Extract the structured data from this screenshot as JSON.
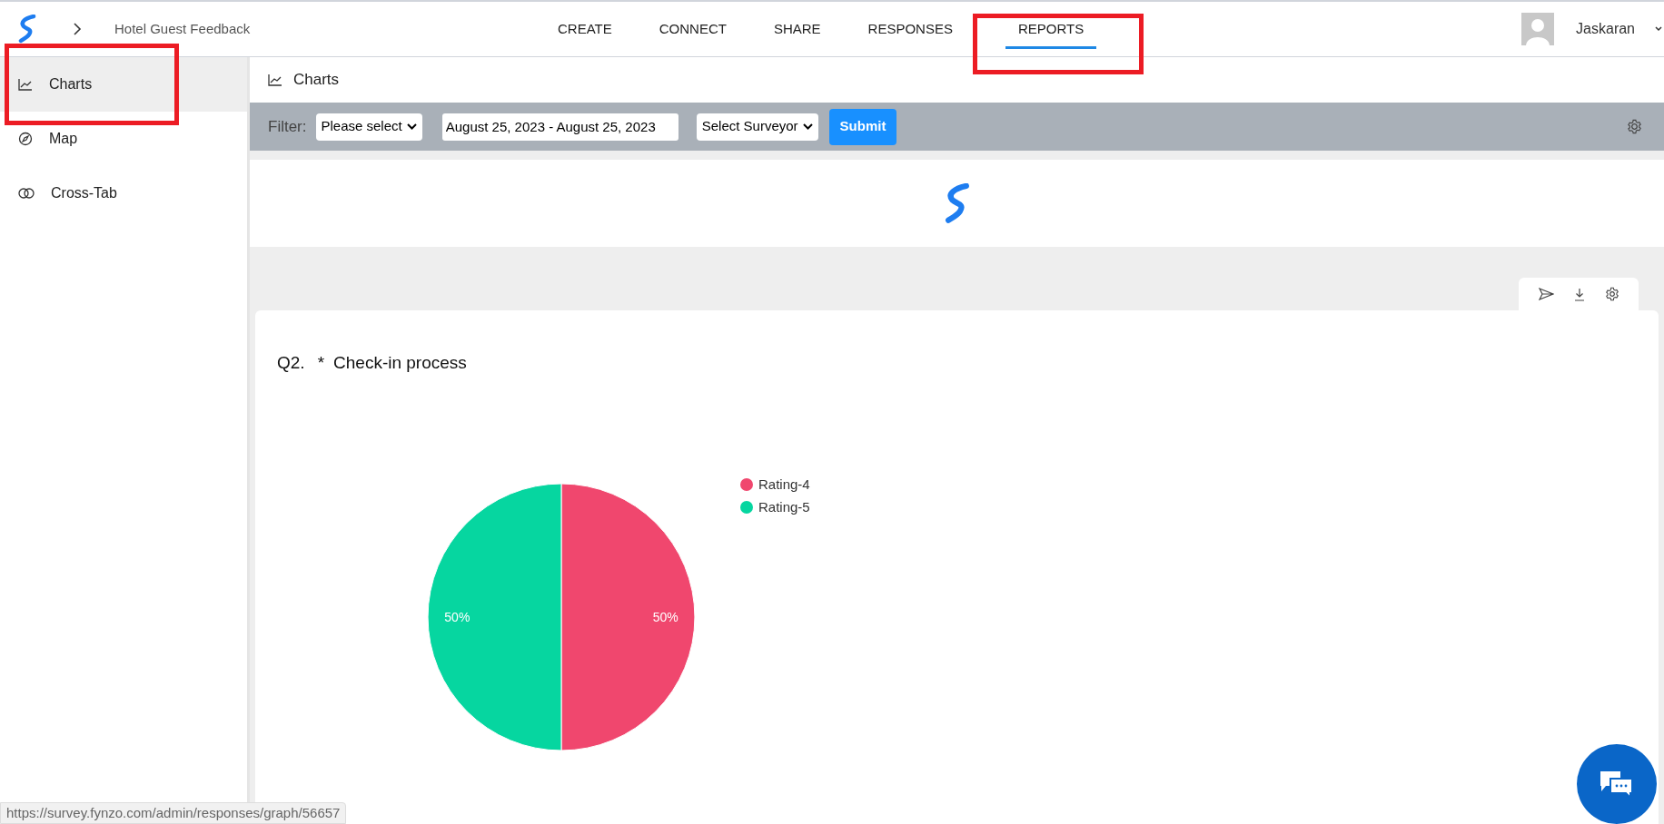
{
  "header": {
    "breadcrumb_title": "Hotel Guest Feedback",
    "nav": [
      {
        "label": "CREATE",
        "selected": false,
        "highlighted": false
      },
      {
        "label": "CONNECT",
        "selected": false,
        "highlighted": false
      },
      {
        "label": "SHARE",
        "selected": false,
        "highlighted": false
      },
      {
        "label": "RESPONSES",
        "selected": false,
        "highlighted": false
      },
      {
        "label": "REPORTS",
        "selected": true,
        "highlighted": true
      }
    ],
    "user": "Jaskaran"
  },
  "sidebar": {
    "items": [
      {
        "label": "Charts",
        "kind": "chart",
        "selected": true,
        "highlighted": true
      },
      {
        "label": "Map",
        "kind": "compass",
        "selected": false,
        "highlighted": false
      },
      {
        "label": "Cross-Tab",
        "kind": "rings",
        "selected": false,
        "highlighted": false
      }
    ]
  },
  "page_title": "Charts",
  "filter": {
    "label": "Filter:",
    "question_select": "Please select",
    "date_range": "August 25, 2023 - August 25, 2023",
    "surveyor_select": "Select Surveyor",
    "submit": "Submit"
  },
  "question": {
    "number": "Q2.",
    "required_mark": "*",
    "title": "Check-in process",
    "chart_data": {
      "type": "pie",
      "categories": [
        "Rating-4",
        "Rating-5"
      ],
      "values": [
        50,
        50
      ],
      "legend": true,
      "colors": [
        "#f0476e",
        "#06d6a0"
      ],
      "value_labels": [
        "50%",
        "50%"
      ]
    }
  },
  "status_bar": {
    "url": "https://survey.fynzo.com/admin/responses/graph/56657"
  }
}
